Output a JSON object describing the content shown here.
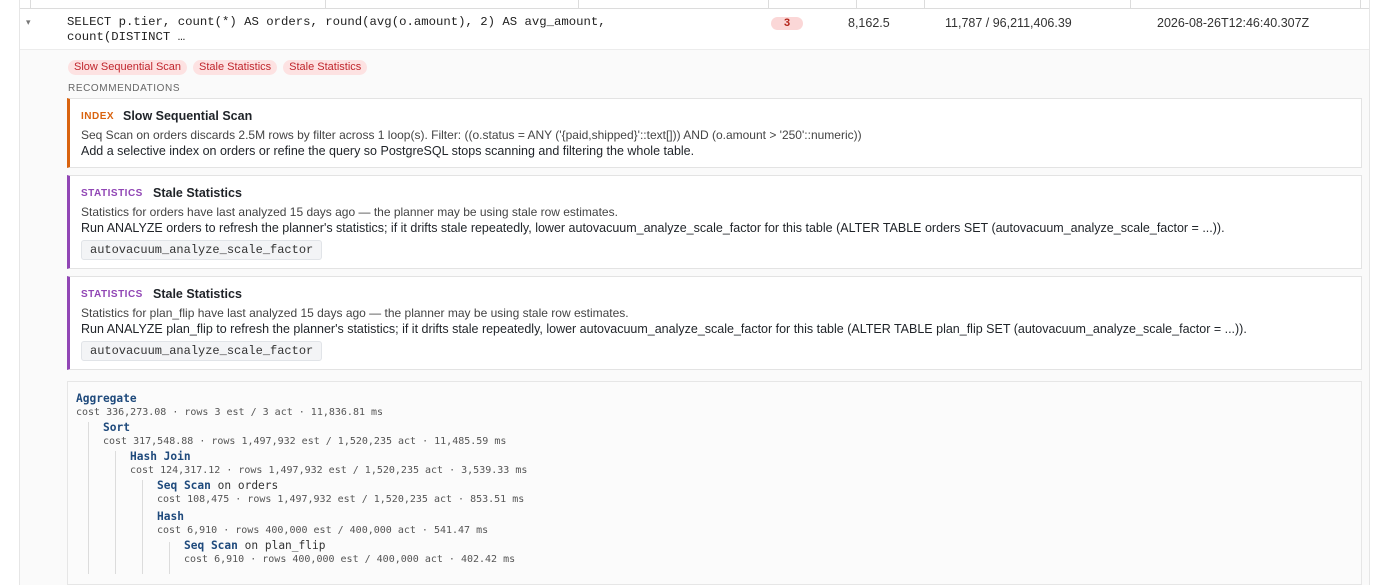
{
  "query_row": {
    "sql": "SELECT p.tier, count(*) AS orders, round(avg(o.amount), 2) AS avg_amount, count(DISTINCT …",
    "issue_count": "3",
    "value_1": "8,162.5",
    "value_2": "11,787 / 96,211,406.39",
    "timestamp": "2026-08-26T12:46:40.307Z",
    "expand_glyph": "▾"
  },
  "tags": [
    "Slow Sequential Scan",
    "Stale Statistics",
    "Stale Statistics"
  ],
  "recommendations_heading": "RECOMMENDATIONS",
  "recommendations": [
    {
      "kind": "INDEX",
      "title": "Slow Sequential Scan",
      "detail": "Seq Scan on orders discards 2.5M rows by filter across 1 loop(s). Filter: ((o.status = ANY ('{paid,shipped}'::text[])) AND (o.amount > '250'::numeric))",
      "advice": "Add a selective index on orders or refine the query so PostgreSQL stops scanning and filtering the whole table.",
      "setting": ""
    },
    {
      "kind": "STATISTICS",
      "title": "Stale Statistics",
      "detail": "Statistics for orders have last analyzed 15 days ago — the planner may be using stale row estimates.",
      "advice": "Run ANALYZE orders to refresh the planner's statistics; if it drifts stale repeatedly, lower autovacuum_analyze_scale_factor for this table (ALTER TABLE orders SET (autovacuum_analyze_scale_factor = ...)).",
      "setting": "autovacuum_analyze_scale_factor"
    },
    {
      "kind": "STATISTICS",
      "title": "Stale Statistics",
      "detail": "Statistics for plan_flip have last analyzed 15 days ago — the planner may be using stale row estimates.",
      "advice": "Run ANALYZE plan_flip to refresh the planner's statistics; if it drifts stale repeatedly, lower autovacuum_analyze_scale_factor for this table (ALTER TABLE plan_flip SET (autovacuum_analyze_scale_factor = ...)).",
      "setting": "autovacuum_analyze_scale_factor"
    }
  ],
  "plan": [
    {
      "name": "Aggregate",
      "target": "",
      "meta": "cost 336,273.08 · rows 3 est / 3 act · 11,836.81 ms"
    },
    {
      "name": "Sort",
      "target": "",
      "meta": "cost 317,548.88 · rows 1,497,932 est / 1,520,235 act · 11,485.59 ms"
    },
    {
      "name": "Hash Join",
      "target": "",
      "meta": "cost 124,317.12 · rows 1,497,932 est / 1,520,235 act · 3,539.33 ms"
    },
    {
      "name": "Seq Scan",
      "target": "on orders",
      "meta": "cost 108,475 · rows 1,497,932 est / 1,520,235 act · 853.51 ms"
    },
    {
      "name": "Hash",
      "target": "",
      "meta": "cost 6,910 · rows 400,000 est / 400,000 act · 541.47 ms"
    },
    {
      "name": "Seq Scan",
      "target": "on plan_flip",
      "meta": "cost 6,910 · rows 400,000 est / 400,000 act · 402.42 ms"
    }
  ]
}
